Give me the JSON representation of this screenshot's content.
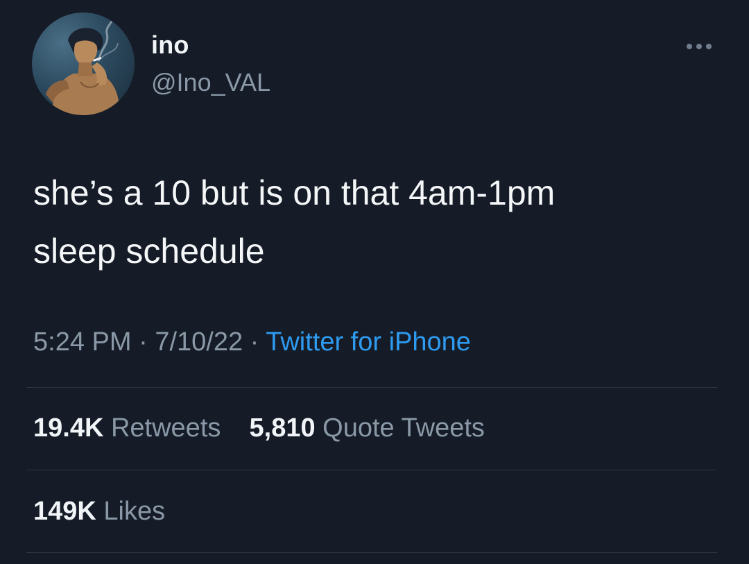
{
  "user": {
    "display_name": "ino",
    "handle": "@Ino_VAL",
    "avatar_icon": "avatar-anime-character-smoking"
  },
  "more_menu": {
    "icon": "more-horizontal-icon"
  },
  "tweet": {
    "text_line1": "she’s a 10 but is on that 4am-1pm",
    "text_line2": "sleep schedule"
  },
  "meta": {
    "time": "5:24 PM",
    "separator": "·",
    "date": "7/10/22",
    "source": "Twitter for iPhone"
  },
  "engagement": {
    "retweets_count": "19.4K",
    "retweets_label": "Retweets",
    "quotes_count": "5,810",
    "quotes_label": "Quote Tweets",
    "likes_count": "149K",
    "likes_label": "Likes"
  },
  "colors": {
    "background": "#151c27",
    "text_primary": "#f2f5f8",
    "text_secondary": "#8a98a7",
    "link": "#2e9bf0",
    "divider": "#2b3542"
  }
}
